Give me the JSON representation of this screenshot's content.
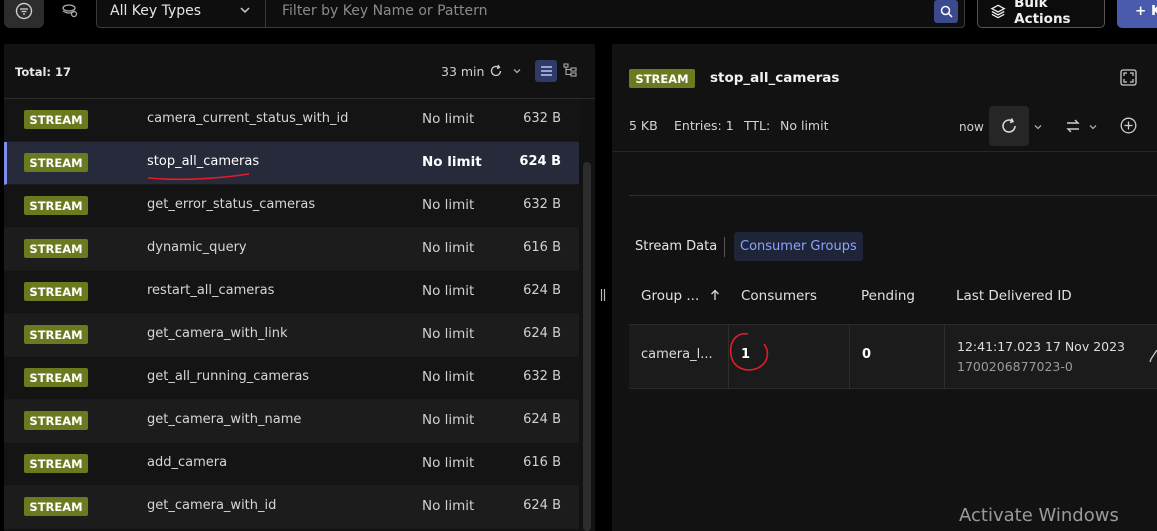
{
  "toolbar": {
    "key_type": "All Key Types",
    "search_placeholder": "Filter by Key Name or Pattern",
    "bulk_actions": "Bulk Actions",
    "add_key": "+ K"
  },
  "list": {
    "total": "Total: 17",
    "age": "33 min",
    "rows": [
      {
        "type": "STREAM",
        "name": "camera_current_status_with_id",
        "ttl": "No limit",
        "size": "632 B"
      },
      {
        "type": "STREAM",
        "name": "stop_all_cameras",
        "ttl": "No limit",
        "size": "624 B"
      },
      {
        "type": "STREAM",
        "name": "get_error_status_cameras",
        "ttl": "No limit",
        "size": "632 B"
      },
      {
        "type": "STREAM",
        "name": "dynamic_query",
        "ttl": "No limit",
        "size": "616 B"
      },
      {
        "type": "STREAM",
        "name": "restart_all_cameras",
        "ttl": "No limit",
        "size": "624 B"
      },
      {
        "type": "STREAM",
        "name": "get_camera_with_link",
        "ttl": "No limit",
        "size": "624 B"
      },
      {
        "type": "STREAM",
        "name": "get_all_running_cameras",
        "ttl": "No limit",
        "size": "632 B"
      },
      {
        "type": "STREAM",
        "name": "get_camera_with_name",
        "ttl": "No limit",
        "size": "624 B"
      },
      {
        "type": "STREAM",
        "name": "add_camera",
        "ttl": "No limit",
        "size": "616 B"
      },
      {
        "type": "STREAM",
        "name": "get_camera_with_id",
        "ttl": "No limit",
        "size": "624 B"
      }
    ]
  },
  "detail": {
    "type": "STREAM",
    "key_name": "stop_all_cameras",
    "size": "5 KB",
    "entries": "Entries: 1",
    "ttl_label": "TTL:",
    "ttl_value": "No limit",
    "refresh_label": "now",
    "tabs": {
      "stream_data": "Stream Data",
      "consumer_groups": "Consumer Groups"
    },
    "columns": {
      "group": "Group ...",
      "consumers": "Consumers",
      "pending": "Pending",
      "last_delivered": "Last Delivered ID"
    },
    "group_row": {
      "group": "camera_l...",
      "consumers": "1",
      "pending": "0",
      "last_delivered_time": "12:41:17.023 17 Nov 2023",
      "last_delivered_id": "1700206877023-0"
    }
  },
  "watermark": "Activate Windows",
  "colors": {
    "stream_badge": "#6a7a1e",
    "accent": "#8ea2ff",
    "annotation": "#e01e2a"
  }
}
